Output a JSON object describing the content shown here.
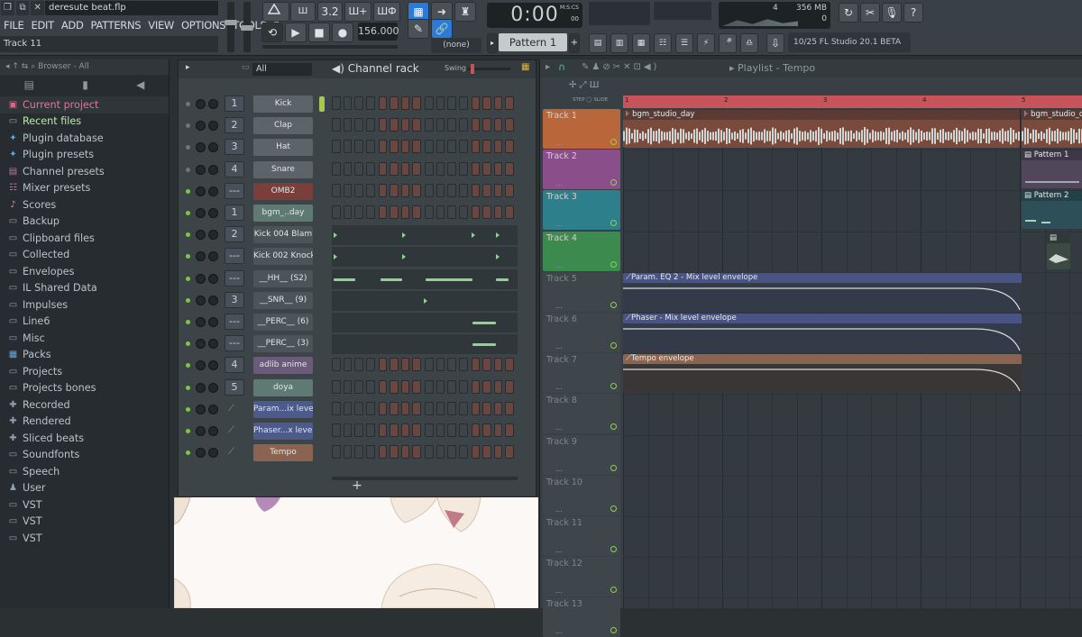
{
  "titlebar": {
    "file": "deresute beat.flp",
    "hint": "Track 11",
    "win_icons": [
      "❐",
      "⧉",
      "✕"
    ]
  },
  "menu": [
    "FILE",
    "EDIT",
    "ADD",
    "PATTERNS",
    "VIEW",
    "OPTIONS",
    "TOOLS",
    "?"
  ],
  "transport": {
    "time": "0:00",
    "time_unit": "M:S:CS",
    "time_sub": "00",
    "tempo": "156.000",
    "pattern": "Pattern 1",
    "snap": "(none)",
    "cpu": "4",
    "ram": "356 MB",
    "poly": "0",
    "news": "10/25  FL Studio 20.1 BETA",
    "mode_buttons": [
      "3.2",
      "Ш+",
      "ШФ"
    ]
  },
  "browser": {
    "header": "Browser - All",
    "items": [
      {
        "label": "Current project",
        "icon": "project-icon"
      },
      {
        "label": "Recent files",
        "icon": "folder-icon"
      },
      {
        "label": "Plugin database",
        "icon": "plugin-icon"
      },
      {
        "label": "Plugin presets",
        "icon": "plugin-icon"
      },
      {
        "label": "Channel presets",
        "icon": "channel-icon"
      },
      {
        "label": "Mixer presets",
        "icon": "mixer-icon"
      },
      {
        "label": "Scores",
        "icon": "note-icon"
      },
      {
        "label": "Backup",
        "icon": "folder-icon"
      },
      {
        "label": "Clipboard files",
        "icon": "folder-icon"
      },
      {
        "label": "Collected",
        "icon": "folder-icon"
      },
      {
        "label": "Envelopes",
        "icon": "folder-icon"
      },
      {
        "label": "IL Shared Data",
        "icon": "folder-icon"
      },
      {
        "label": "Impulses",
        "icon": "folder-icon"
      },
      {
        "label": "Line6",
        "icon": "folder-icon"
      },
      {
        "label": "Misc",
        "icon": "folder-icon"
      },
      {
        "label": "Packs",
        "icon": "pack-icon"
      },
      {
        "label": "Projects",
        "icon": "folder-icon"
      },
      {
        "label": "Projects bones",
        "icon": "folder-icon"
      },
      {
        "label": "Recorded",
        "icon": "plus-icon"
      },
      {
        "label": "Rendered",
        "icon": "plus-icon"
      },
      {
        "label": "Sliced beats",
        "icon": "plus-icon"
      },
      {
        "label": "Soundfonts",
        "icon": "folder-icon"
      },
      {
        "label": "Speech",
        "icon": "folder-icon"
      },
      {
        "label": "User",
        "icon": "user-icon"
      },
      {
        "label": "VST",
        "icon": "folder-icon"
      },
      {
        "label": "VST",
        "icon": "folder-icon"
      },
      {
        "label": "VST",
        "icon": "folder-icon"
      }
    ]
  },
  "rack": {
    "filter": "All",
    "title": "Channel rack",
    "swing_label": "Swing",
    "add": "+",
    "channels": [
      {
        "num": "1",
        "name": "Kick",
        "color": "#5d6469",
        "mode": "steps"
      },
      {
        "num": "2",
        "name": "Clap",
        "color": "#5d6469",
        "mode": "steps"
      },
      {
        "num": "3",
        "name": "Hat",
        "color": "#5d6469",
        "mode": "steps"
      },
      {
        "num": "4",
        "name": "Snare",
        "color": "#5d6469",
        "mode": "steps"
      },
      {
        "num": "---",
        "name": "OMB2",
        "color": "#7a3f3b",
        "mode": "steps"
      },
      {
        "num": "1",
        "name": "bgm_..day",
        "color": "#5f7a73",
        "mode": "steps"
      },
      {
        "num": "2",
        "name": "Kick 004 Blam",
        "color": "#4b5459",
        "mode": "roll"
      },
      {
        "num": "---",
        "name": "Kick 002 Knock",
        "color": "#4b5459",
        "mode": "roll"
      },
      {
        "num": "---",
        "name": "__HH__ (S2)",
        "color": "#4b5459",
        "mode": "roll"
      },
      {
        "num": "3",
        "name": "__SNR__ (9)",
        "color": "#4b5459",
        "mode": "roll"
      },
      {
        "num": "---",
        "name": "__PERC__ (6)",
        "color": "#4b5459",
        "mode": "roll"
      },
      {
        "num": "---",
        "name": "__PERC__ (3)",
        "color": "#4b5459",
        "mode": "roll"
      },
      {
        "num": "4",
        "name": "adlib anime",
        "color": "#6c5a7a",
        "mode": "steps"
      },
      {
        "num": "5",
        "name": "doya",
        "color": "#5f7a73",
        "mode": "steps"
      },
      {
        "num": "",
        "name": "Param...ix level",
        "color": "#4d5a8c",
        "mode": "steps"
      },
      {
        "num": "",
        "name": "Phaser...x level",
        "color": "#4d5a8c",
        "mode": "steps"
      },
      {
        "num": "",
        "name": "Tempo",
        "color": "#8a6450",
        "mode": "steps"
      }
    ]
  },
  "playlist": {
    "title": "Playlist - Tempo",
    "snap_labels": [
      "STEP",
      "SLIDE"
    ],
    "bars": [
      "1",
      "2",
      "3",
      "4",
      "5"
    ],
    "tracks": [
      {
        "label": "Track 1",
        "color": "#b8663a"
      },
      {
        "label": "Track 2",
        "color": "#8a4f8a"
      },
      {
        "label": "Track 3",
        "color": "#2e7f8c"
      },
      {
        "label": "Track 4",
        "color": "#3d8a4f"
      },
      {
        "label": "Track 5",
        "color": "#3f464b"
      },
      {
        "label": "Track 6",
        "color": "#3f464b"
      },
      {
        "label": "Track 7",
        "color": "#3f464b"
      },
      {
        "label": "Track 8",
        "color": "#3f464b"
      },
      {
        "label": "Track 9",
        "color": "#3f464b"
      },
      {
        "label": "Track 10",
        "color": "#3f464b"
      },
      {
        "label": "Track 11",
        "color": "#3f464b"
      },
      {
        "label": "Track 12",
        "color": "#3f464b"
      },
      {
        "label": "Track 13",
        "color": "#3f464b"
      }
    ],
    "clips": {
      "audio1": "bgm_studio_day",
      "audio2": "bgm_studio_d",
      "pat1": "Pattern 1",
      "pat2": "Pattern 2",
      "env1": "Param. EQ 2 - Mix level envelope",
      "env2": "Phaser - Mix level envelope",
      "env3": "Tempo envelope"
    }
  }
}
